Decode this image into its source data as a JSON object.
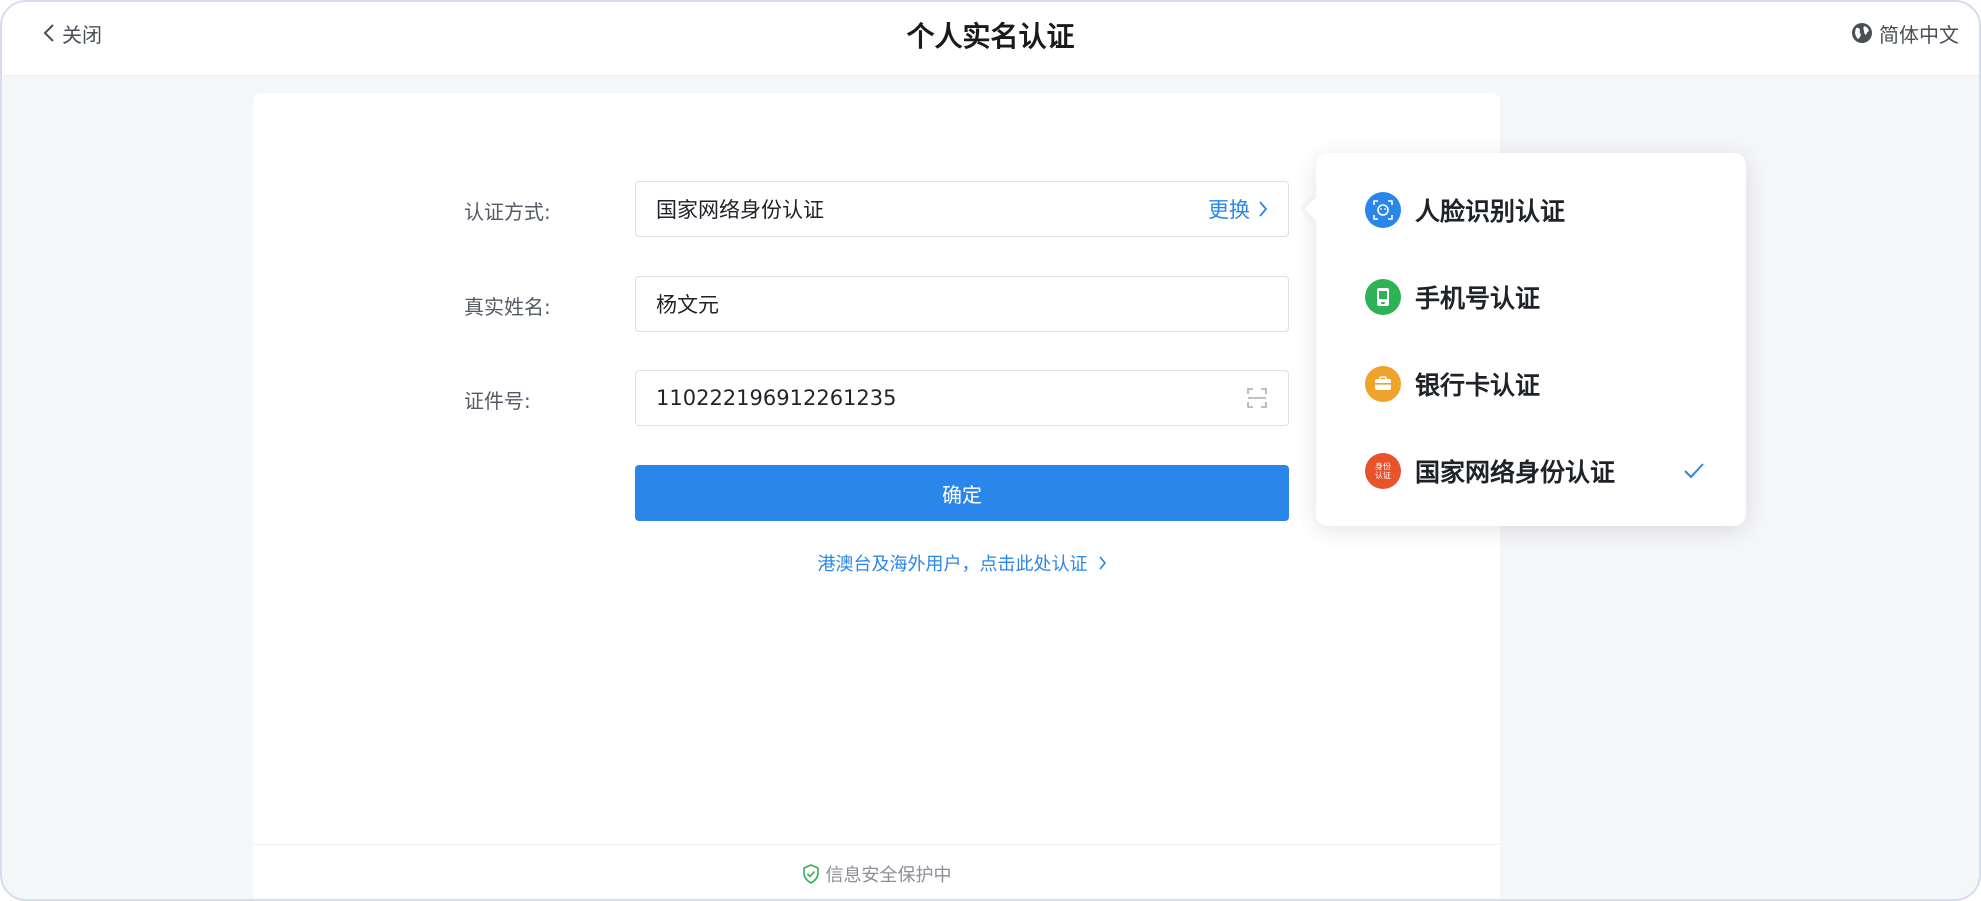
{
  "header": {
    "close_label": "关闭",
    "title": "个人实名认证",
    "language_label": "简体中文"
  },
  "form": {
    "method_label": "认证方式:",
    "method_value": "国家网络身份认证",
    "change_label": "更换",
    "name_label": "真实姓名:",
    "name_value": "杨文元",
    "id_label": "证件号:",
    "id_value": "110222196912261235",
    "confirm_label": "确定",
    "overseas_link": "港澳台及海外用户，点击此处认证"
  },
  "footer": {
    "security_text": "信息安全保护中"
  },
  "method_menu": {
    "options": [
      {
        "label": "人脸识别认证",
        "icon": "face-recognition-icon",
        "color": "#2b86ea",
        "selected": false
      },
      {
        "label": "手机号认证",
        "icon": "mobile-phone-icon",
        "color": "#2db256",
        "selected": false
      },
      {
        "label": "银行卡认证",
        "icon": "bank-card-icon",
        "color": "#f0a32a",
        "selected": false
      },
      {
        "label": "国家网络身份认证",
        "icon": "national-id-icon",
        "icon_text": "身份认证",
        "color": "#e8532b",
        "selected": true
      }
    ]
  },
  "colors": {
    "accent": "#2b86ea",
    "background": "#f5f6f8",
    "frame_border": "#d6dcef"
  }
}
